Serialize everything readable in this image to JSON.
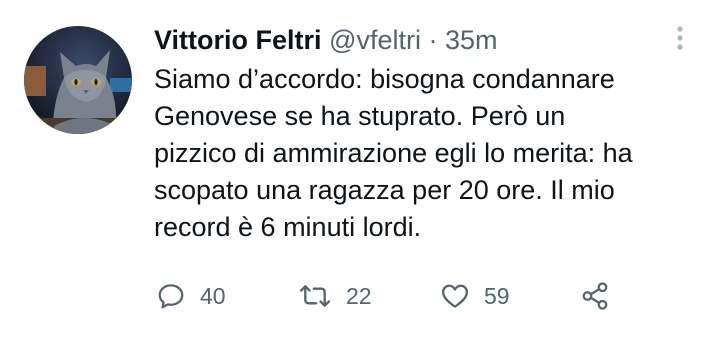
{
  "tweet": {
    "author_name": "Vittorio Feltri",
    "handle": "@vfeltri",
    "separator": "·",
    "time": "35m",
    "text": "Siamo d’accordo: bisogna condannare\nGenovese se ha stuprato. Però un\npizzico di ammirazione egli lo merita: ha\nscopato una ragazza per 20 ore. Il mio\nrecord è  6 minuti lordi.",
    "avatar_icon": "cat-avatar",
    "more_icon": "vertical-ellipsis-icon"
  },
  "actions": {
    "reply": {
      "icon": "reply-icon",
      "count": "40"
    },
    "retweet": {
      "icon": "retweet-icon",
      "count": "22"
    },
    "like": {
      "icon": "heart-icon",
      "count": "59"
    },
    "share": {
      "icon": "share-icon"
    }
  },
  "colors": {
    "text": "#0f1419",
    "secondary": "#536471",
    "background": "#ffffff"
  }
}
